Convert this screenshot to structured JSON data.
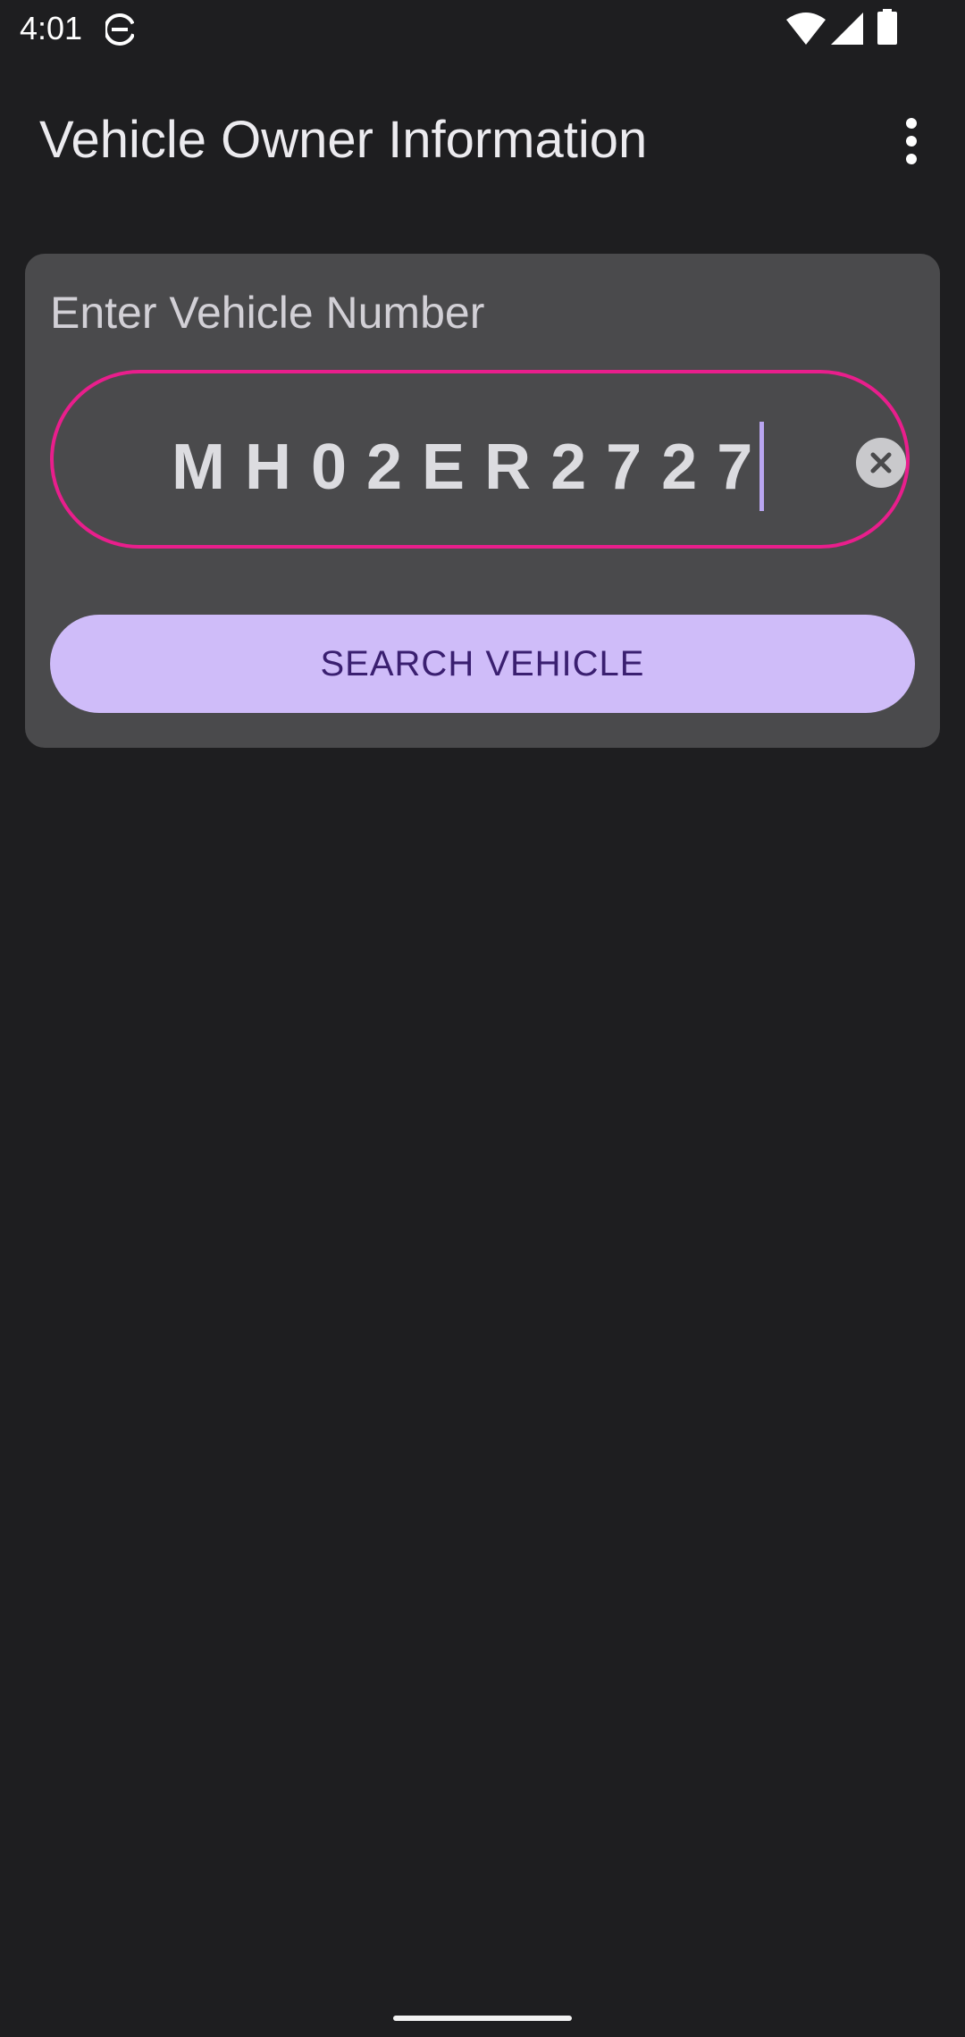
{
  "status_bar": {
    "time": "4:01",
    "icons": [
      "data-saver-icon",
      "wifi-icon",
      "signal-icon",
      "battery-icon"
    ]
  },
  "app_bar": {
    "title": "Vehicle Owner Information",
    "menu_icon": "more-vert-icon"
  },
  "search_card": {
    "label": "Enter Vehicle Number",
    "vehicle_number": "MH02ER2727",
    "clear_icon": "clear-circle-icon",
    "button_label": "SEARCH VEHICLE"
  },
  "colors": {
    "background": "#1e1e20",
    "card": "#4a4a4c",
    "field_border": "#e91e8c",
    "button": "#cfbcf9",
    "button_text": "#3a1f70"
  }
}
